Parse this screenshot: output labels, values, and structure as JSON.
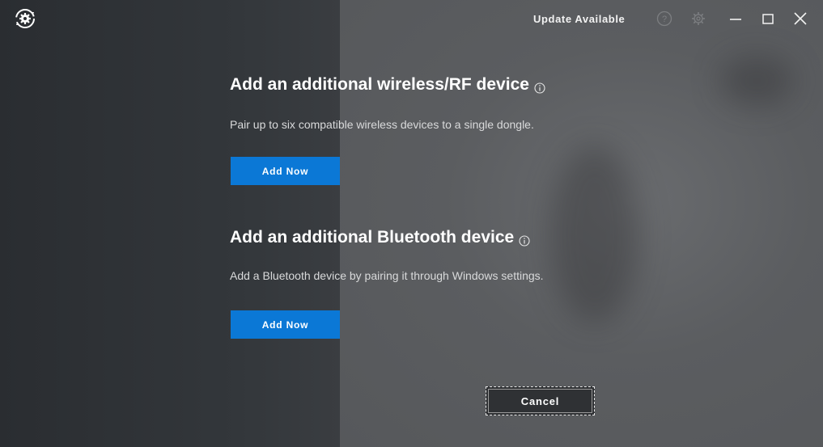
{
  "titlebar": {
    "update_label": "Update Available",
    "icons": [
      "app-logo-icon",
      "help-icon",
      "settings-icon",
      "minimize-icon",
      "maximize-icon",
      "close-icon"
    ]
  },
  "rf_section": {
    "title": "Add an additional wireless/RF device",
    "description": "Pair up to six compatible wireless devices to a single dongle.",
    "button_label": "Add Now"
  },
  "bt_section": {
    "title": "Add an additional Bluetooth device",
    "description": "Add a Bluetooth device by pairing it through Windows settings.",
    "button_label": "Add Now"
  },
  "footer": {
    "cancel_label": "Cancel"
  },
  "colors": {
    "accent": "#0b78d6",
    "panel_dark": "#2a2d31",
    "panel_light": "#5b5d60"
  }
}
